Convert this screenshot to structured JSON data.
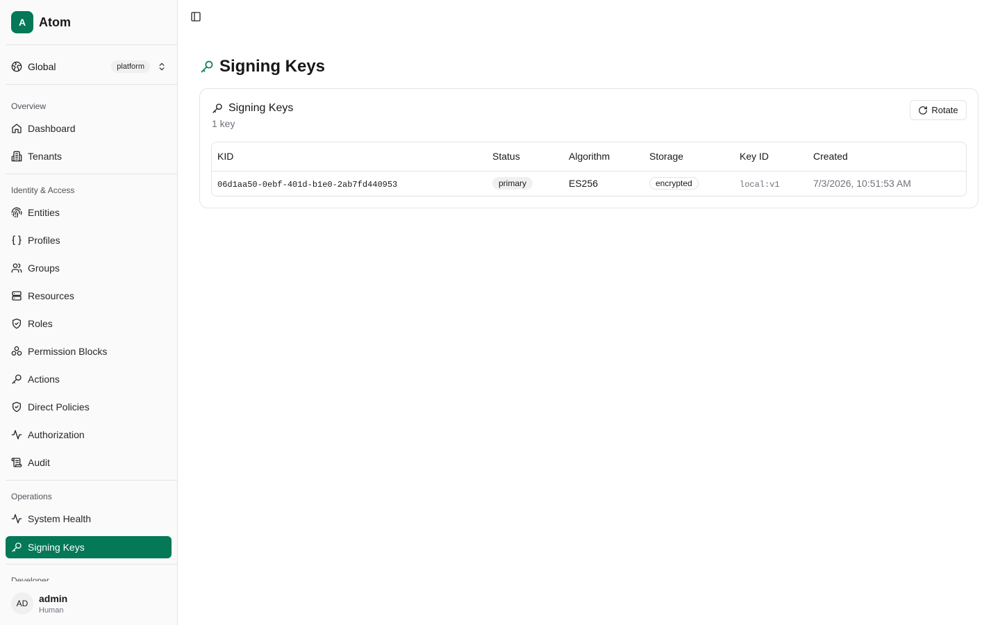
{
  "app": {
    "logo_letter": "A",
    "name": "Atom"
  },
  "scope": {
    "label": "Global",
    "badge": "platform"
  },
  "nav": {
    "overview": {
      "title": "Overview",
      "items": [
        {
          "label": "Dashboard"
        },
        {
          "label": "Tenants"
        }
      ]
    },
    "identity": {
      "title": "Identity & Access",
      "items": [
        {
          "label": "Entities"
        },
        {
          "label": "Profiles"
        },
        {
          "label": "Groups"
        },
        {
          "label": "Resources"
        },
        {
          "label": "Roles"
        },
        {
          "label": "Permission Blocks"
        },
        {
          "label": "Actions"
        },
        {
          "label": "Direct Policies"
        },
        {
          "label": "Authorization"
        },
        {
          "label": "Audit"
        }
      ]
    },
    "operations": {
      "title": "Operations",
      "items": [
        {
          "label": "System Health"
        },
        {
          "label": "Signing Keys"
        }
      ]
    },
    "developer": {
      "title": "Developer"
    }
  },
  "user": {
    "initials": "AD",
    "name": "admin",
    "role": "Human"
  },
  "page": {
    "title": "Signing Keys"
  },
  "card": {
    "title": "Signing Keys",
    "subtitle": "1 key",
    "rotate_label": "Rotate",
    "columns": [
      "KID",
      "Status",
      "Algorithm",
      "Storage",
      "Key ID",
      "Created"
    ],
    "rows": [
      {
        "kid": "06d1aa50-0ebf-401d-b1e0-2ab7fd440953",
        "status": "primary",
        "algorithm": "ES256",
        "storage": "encrypted",
        "key_id": "local:v1",
        "created": "7/3/2026, 10:51:53 AM"
      }
    ]
  },
  "colors": {
    "accent": "#047857",
    "border": "#e4e4e7",
    "muted": "#71717a"
  }
}
